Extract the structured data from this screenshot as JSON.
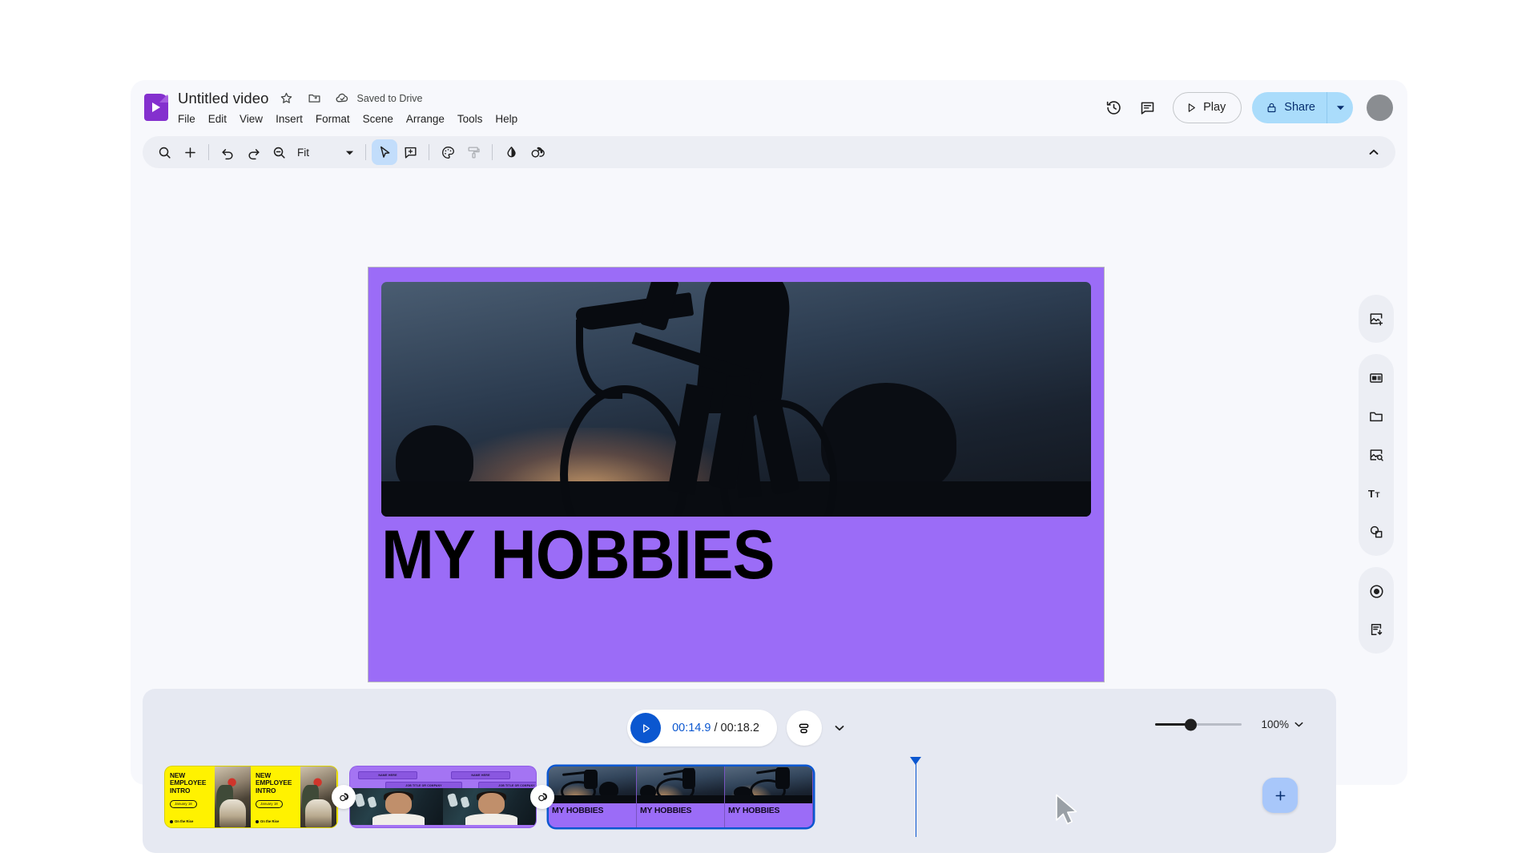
{
  "app": {
    "name": "Google Vids",
    "doc_title": "Untitled video",
    "save_status": "Saved to Drive"
  },
  "header": {
    "icons": [
      {
        "name": "star-icon",
        "glyph": "star"
      },
      {
        "name": "move-to-folder-icon",
        "glyph": "folder-move"
      },
      {
        "name": "cloud-saved-icon",
        "glyph": "cloud-done"
      }
    ],
    "menu": [
      "File",
      "Edit",
      "View",
      "Insert",
      "Format",
      "Scene",
      "Arrange",
      "Tools",
      "Help"
    ],
    "version_history_icon": "history-icon",
    "comments_icon": "comment-icon",
    "play_label": "Play",
    "share_label": "Share",
    "accent_blue": "#0b57d0",
    "share_bg": "#aadcfb"
  },
  "toolbar": {
    "zoom_level_label": "Fit",
    "items": [
      {
        "name": "search-icon",
        "label": "Search"
      },
      {
        "name": "add-icon",
        "label": "Insert"
      },
      {
        "name": "undo-icon",
        "label": "Undo"
      },
      {
        "name": "redo-icon",
        "label": "Redo"
      },
      {
        "name": "zoom-icon",
        "label": "Zoom"
      },
      {
        "name": "select-cursor-icon",
        "label": "Select"
      },
      {
        "name": "add-comment-icon",
        "label": "Add comment"
      },
      {
        "name": "theme-palette-icon",
        "label": "Theme"
      },
      {
        "name": "format-paint-icon",
        "label": "Paint format"
      },
      {
        "name": "fill-color-icon",
        "label": "Fill color"
      },
      {
        "name": "transition-icon",
        "label": "Transition"
      }
    ],
    "collapse_icon": "chevron-up-icon"
  },
  "canvas": {
    "slide_title": "MY HOBBIES",
    "background_color": "#9b6cf7",
    "media_description": "Cyclist silhouette at dusk"
  },
  "right_rail": {
    "groups": [
      [
        {
          "name": "add-media-icon",
          "label": "Add media"
        }
      ],
      [
        {
          "name": "templates-icon",
          "label": "Templates"
        },
        {
          "name": "folder-icon",
          "label": "Drive files"
        },
        {
          "name": "stock-media-icon",
          "label": "Stock media"
        },
        {
          "name": "text-icon",
          "label": "Text"
        },
        {
          "name": "shapes-icon",
          "label": "Shapes"
        }
      ],
      [
        {
          "name": "record-icon",
          "label": "Record"
        },
        {
          "name": "export-icon",
          "label": "Export"
        }
      ]
    ]
  },
  "timeline": {
    "current_time": "00:14.9",
    "total_time": "/ 00:18.2",
    "play_icon": "play-icon",
    "view_toggle_icon": "track-view-icon",
    "expand_icon": "chevron-down-icon",
    "zoom_percent": "100%",
    "zoom_caret_icon": "chevron-down-icon",
    "zoom_slider_value": 40,
    "add_clip_icon": "plus-icon",
    "clips": [
      {
        "name": "clip-new-employee-intro",
        "type": "scene",
        "selected": false,
        "headline": "NEW\nEMPLOYEE\nINTRO",
        "badge": "January 18",
        "footer": "On the Rise",
        "bg": "#fff200"
      },
      {
        "name": "clip-talking-head",
        "type": "scene",
        "selected": false,
        "label_top": "NAME HERE",
        "label_sub": "JOB TITLE OR COMPANY",
        "bg": "#a474f3"
      },
      {
        "name": "clip-my-hobbies",
        "type": "scene",
        "selected": true,
        "label": "MY HOBBIES",
        "bg": "#9b6cf7"
      }
    ],
    "transitions": [
      {
        "name": "transition-node-1",
        "icon": "transition-icon"
      },
      {
        "name": "transition-node-2",
        "icon": "transition-icon"
      }
    ]
  }
}
